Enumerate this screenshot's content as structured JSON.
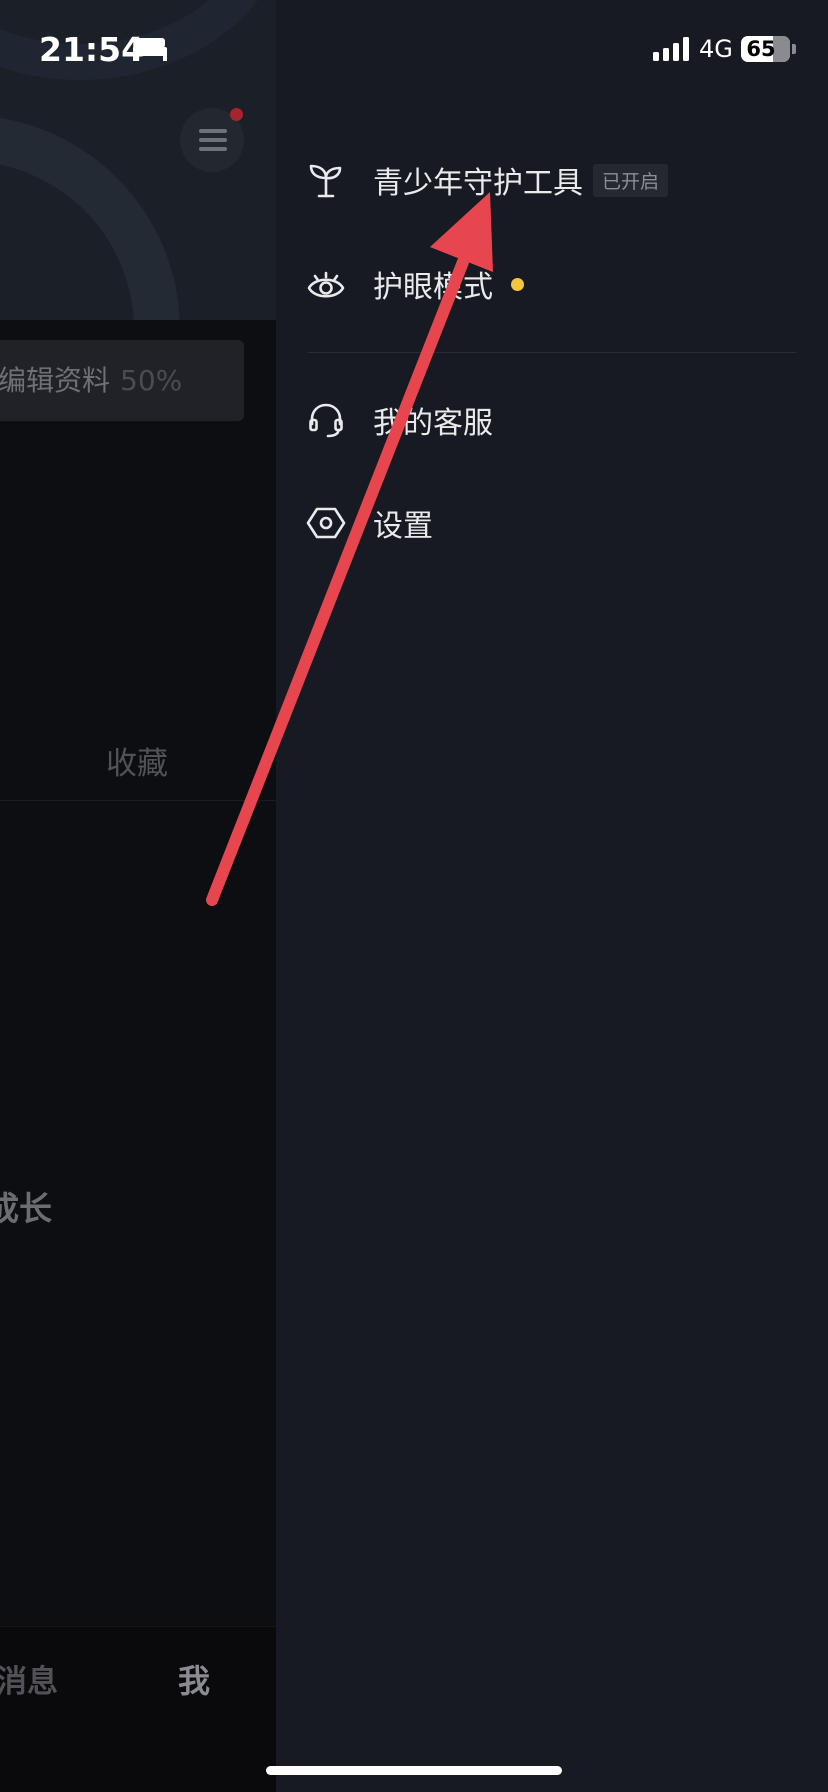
{
  "status_bar": {
    "time": "21:54",
    "network": "4G",
    "battery_level": "65",
    "icons": [
      "bed-icon",
      "signal-icon",
      "battery-icon"
    ]
  },
  "background_page": {
    "edit_profile_label": "编辑资料",
    "edit_profile_percent": "50%",
    "favorites_tab": "收藏",
    "growth_text": "成长",
    "bottom_nav": {
      "messages": "消息",
      "me": "我"
    }
  },
  "drawer": {
    "items": [
      {
        "label": "青少年守护工具",
        "icon": "sprout-icon",
        "badge": "已开启"
      },
      {
        "label": "护眼模式",
        "icon": "eye-icon",
        "dot_color": "#f3c73c"
      },
      {
        "label": "我的客服",
        "icon": "headset-icon"
      },
      {
        "label": "设置",
        "icon": "settings-hexagon-icon"
      }
    ]
  },
  "colors": {
    "drawer_background": "#171a22",
    "annotation_arrow": "#e8464e",
    "notification_dot": "#a6242c",
    "eye_mode_dot": "#f3c73c"
  }
}
